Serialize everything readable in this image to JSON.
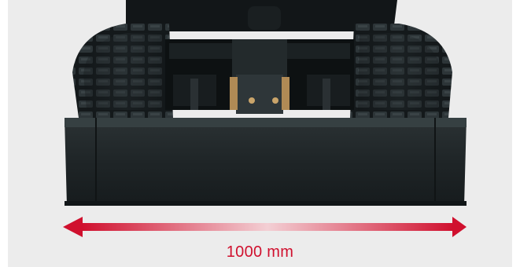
{
  "dimension": {
    "value_label": "1000 mm",
    "arrow_color": "#d0102e"
  },
  "scene": {
    "background_color": "#ececec",
    "machine_color": "#1e2325",
    "accent_color": "#b08a55",
    "icons": [
      "excavator-dozer-blade-image",
      "double-arrow-icon"
    ]
  }
}
